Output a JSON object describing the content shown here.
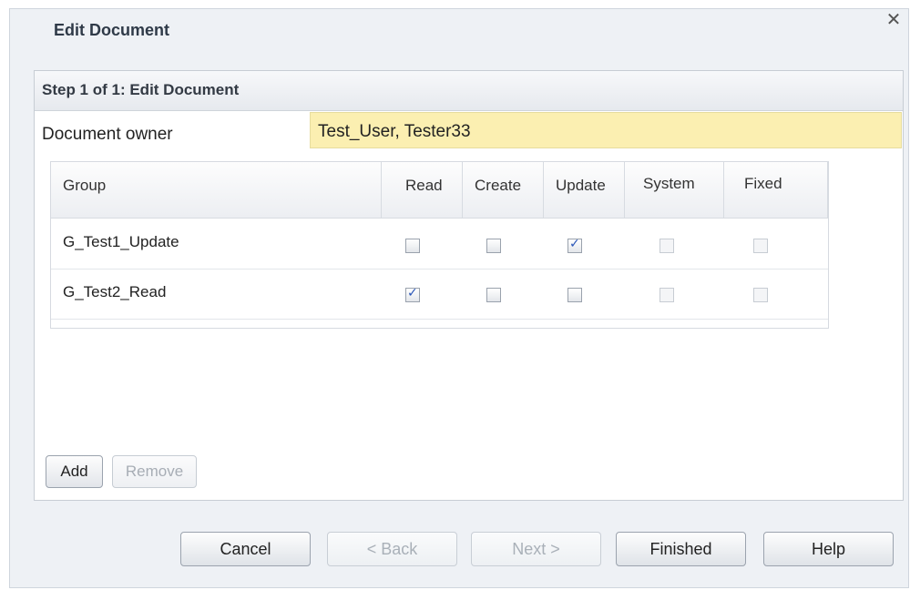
{
  "dialog": {
    "title": "Edit Document",
    "close_icon": "close-icon"
  },
  "step": {
    "label": "Step 1 of 1: Edit Document"
  },
  "owner": {
    "label": "Document owner",
    "value": "Test_User, Tester33"
  },
  "grid": {
    "columns": [
      "Group",
      "Read",
      "Create",
      "Update",
      "System",
      "Fixed"
    ],
    "rows": [
      {
        "group": "G_Test1_Update",
        "read": false,
        "create": false,
        "update": true,
        "system": false,
        "fixed": false
      },
      {
        "group": "G_Test2_Read",
        "read": true,
        "create": false,
        "update": false,
        "system": false,
        "fixed": false
      }
    ]
  },
  "actions": {
    "add": "Add",
    "remove": "Remove"
  },
  "footer": {
    "cancel": "Cancel",
    "back": "< Back",
    "next": "Next >",
    "finished": "Finished",
    "help": "Help"
  },
  "colors": {
    "owner_highlight": "#fbefb1",
    "check_accent": "#2a56b8"
  }
}
